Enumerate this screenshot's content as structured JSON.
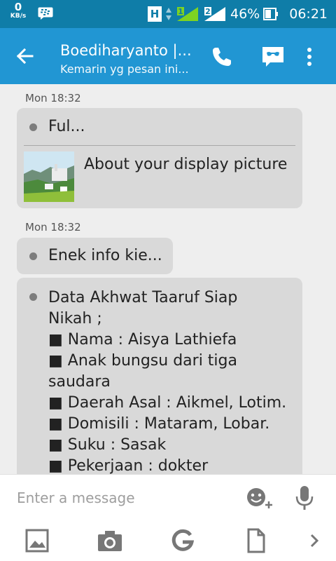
{
  "status_bar": {
    "speed_value": "0",
    "speed_unit": "KB/s",
    "sim1": "1",
    "sim2": "2",
    "network_type": "H",
    "battery": "46%",
    "time": "06:21"
  },
  "header": {
    "title": "Boediharyanto |...",
    "subtitle": "Kemarin yg pesan ini..."
  },
  "messages": [
    {
      "timestamp": "Mon 18:32",
      "bubbles": [
        {
          "text": "Ful...",
          "attachment": {
            "caption": "About your display picture"
          }
        }
      ]
    },
    {
      "timestamp": "Mon 18:32",
      "bubbles": [
        {
          "text": "Enek info kie..."
        },
        {
          "lines": [
            "Data Akhwat Taaruf Siap",
            "Nikah ;",
            "■ Nama : Aisya Lathiefa",
            "■ Anak bungsu dari tiga",
            "saudara",
            "■ Daerah Asal : Aikmel, Lotim.",
            "■ Domisili : Mataram, Lobar.",
            "■ Suku : Sasak",
            "■ Pekerjaan : dokter"
          ]
        }
      ]
    }
  ],
  "composer": {
    "placeholder": "Enter a message"
  },
  "toolbar_icons": [
    "picture-icon",
    "camera-icon",
    "google-icon",
    "document-icon",
    "chevron-right-icon"
  ],
  "colors": {
    "status_bar": "#0f7da8",
    "app_bar": "#2196d3",
    "bubble": "#d9d9d9",
    "background": "#eeeeee"
  }
}
